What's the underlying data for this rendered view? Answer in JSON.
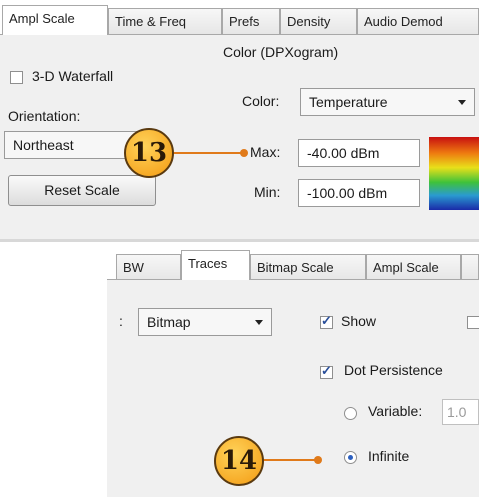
{
  "top_panel": {
    "tabs": [
      {
        "label": "Ampl Scale",
        "active": true
      },
      {
        "label": "Time & Freq",
        "active": false
      },
      {
        "label": "Prefs",
        "active": false
      },
      {
        "label": "Density",
        "active": false
      },
      {
        "label": "Audio Demod",
        "active": false
      }
    ],
    "waterfall_label": "3-D Waterfall",
    "waterfall_checked": false,
    "orientation_label": "Orientation:",
    "orientation_value": "Northeast",
    "reset_button": "Reset Scale",
    "color_group_title": "Color (DPXogram)",
    "color_label": "Color:",
    "color_value": "Temperature",
    "max_label": "Max:",
    "max_value": "-40.00 dBm",
    "min_label": "Min:",
    "min_value": "-100.00 dBm"
  },
  "bottom_panel": {
    "tabs": [
      {
        "label": "BW",
        "active": false
      },
      {
        "label": "Traces",
        "active": true
      },
      {
        "label": "Bitmap Scale",
        "active": false
      },
      {
        "label": "Ampl Scale",
        "active": false
      }
    ],
    "prefix": ":",
    "trace_value": "Bitmap",
    "show_label": "Show",
    "show_checked": true,
    "dot_persistence_label": "Dot Persistence",
    "dot_persistence_checked": true,
    "variable_label": "Variable:",
    "variable_value": "1.0",
    "variable_selected": false,
    "infinite_label": "Infinite",
    "infinite_selected": true
  },
  "callouts": {
    "first": "13",
    "second": "14"
  },
  "colors": {
    "callout_fill": "#f7a51c",
    "leader": "#e07a1a",
    "panel_bg": "#f0f0f0"
  }
}
